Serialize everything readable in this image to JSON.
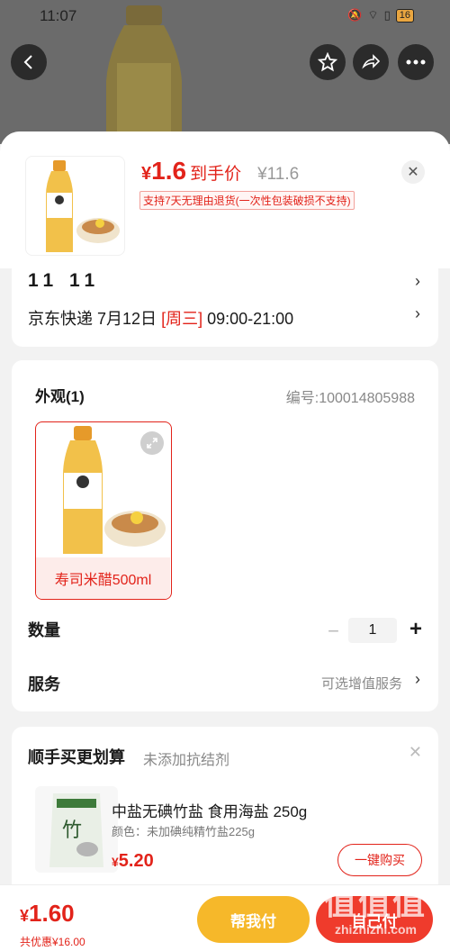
{
  "status_bar": {
    "time": "11:07",
    "battery": "16"
  },
  "header_buttons": {
    "back": "back-icon",
    "favorite": "star-icon",
    "share": "share-icon",
    "more": "more-icon"
  },
  "product": {
    "price_yen": "¥",
    "price": "1.6",
    "price_label": "到手价",
    "original_price": "¥11.6",
    "return_policy": "支持7天无理由退货(一次性包装破损不支持)"
  },
  "address": {
    "name": "11  11",
    "carrier": "京东快递",
    "date": "7月12日",
    "weekday": "[周三]",
    "time_window": "09:00-21:00"
  },
  "spec": {
    "title": "外观(1)",
    "sku": "编号:100014805988",
    "option_label": "寿司米醋500ml",
    "quantity_label": "数量",
    "quantity": "1",
    "minus": "−",
    "plus": "+",
    "service_label": "服务",
    "service_hint": "可选增值服务"
  },
  "recommend": {
    "title": "顺手买更划算",
    "subtitle": "未添加抗结剂",
    "item_name": "中盐无碘竹盐 食用海盐 250g",
    "item_attr": "颜色：未加碘纯精竹盐225g",
    "price_yen": "¥",
    "price": "5.20",
    "buy_label": "一键购买"
  },
  "bottom_bar": {
    "total_yen": "¥",
    "total": "1.60",
    "saving": "共优惠¥16.00",
    "help_pay": "帮我付",
    "self_pay": "自己付"
  },
  "watermark": {
    "logo": "值值值",
    "site": "zhizhizhi.com"
  },
  "colors": {
    "accent": "#e2231a",
    "help_button": "#f6b82a",
    "self_button": "#ef3b2c"
  }
}
